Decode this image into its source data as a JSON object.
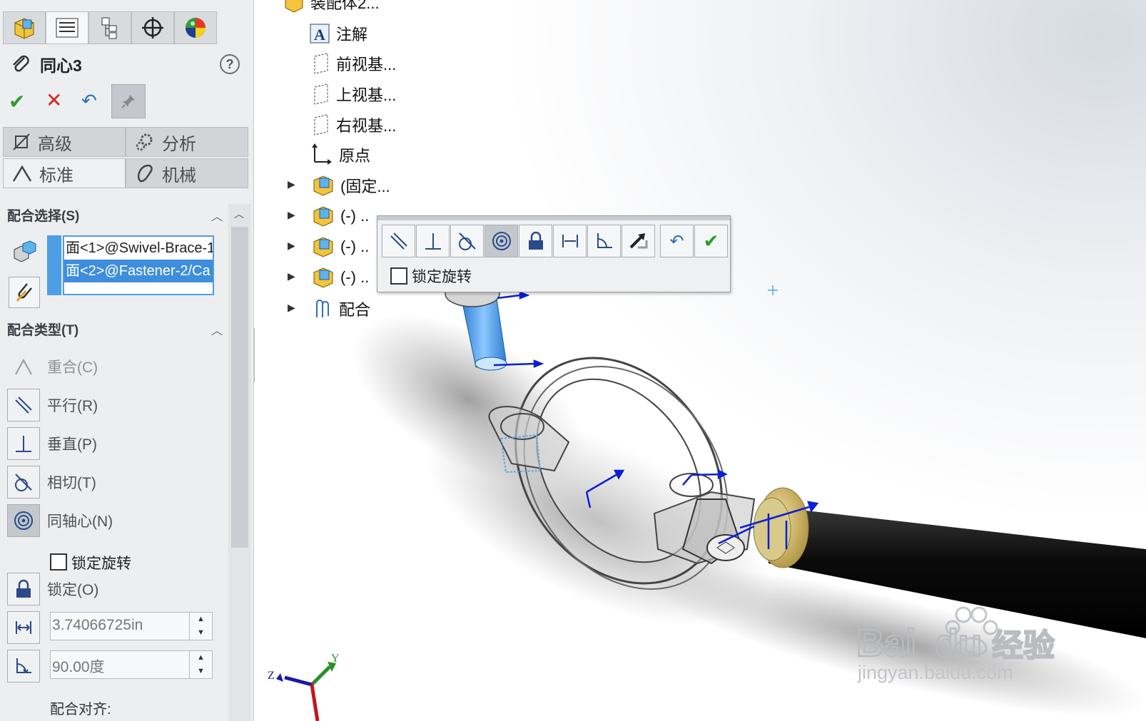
{
  "property_manager": {
    "title": "同心3",
    "help": "?",
    "mode_tabs": [
      {
        "label": "高级"
      },
      {
        "label": "分析"
      },
      {
        "label": "标准"
      },
      {
        "label": "机械"
      }
    ],
    "mate_selection": {
      "header": "配合选择(S)",
      "items": [
        "面<1>@Swivel-Brace-1",
        "面<2>@Fastener-2/Ca"
      ]
    },
    "mate_types": {
      "header": "配合类型(T)",
      "coincident": "重合(C)",
      "parallel": "平行(R)",
      "perpendicular": "垂直(P)",
      "tangent": "相切(T)",
      "concentric": "同轴心(N)",
      "lock_rotation": "锁定旋转",
      "lock": "锁定(O)",
      "distance_value": "3.74066725in",
      "angle_value": "90.00度",
      "alignment_label": "配合对齐:"
    }
  },
  "feature_tree": {
    "root": "装配体2...",
    "items": [
      "注解",
      "前视基...",
      "上视基...",
      "右视基...",
      "原点",
      "(固定...",
      "(-) ..",
      "(-) ..",
      "(-) ..",
      "配合"
    ]
  },
  "context_toolbar": {
    "lock_rotation": "锁定旋转"
  },
  "triad": {
    "z": "Z",
    "y": "Y"
  },
  "watermark": {
    "brand": "Bai",
    "brand2": "du",
    "cn": "经验",
    "url": "jingyan.baidu.com"
  },
  "colors": {
    "ok": "#2e9b2e",
    "cancel": "#d7261e",
    "selection": "#3e8edd",
    "part_blue": "#4a9ae8",
    "shaft": "#0d0d0d"
  }
}
